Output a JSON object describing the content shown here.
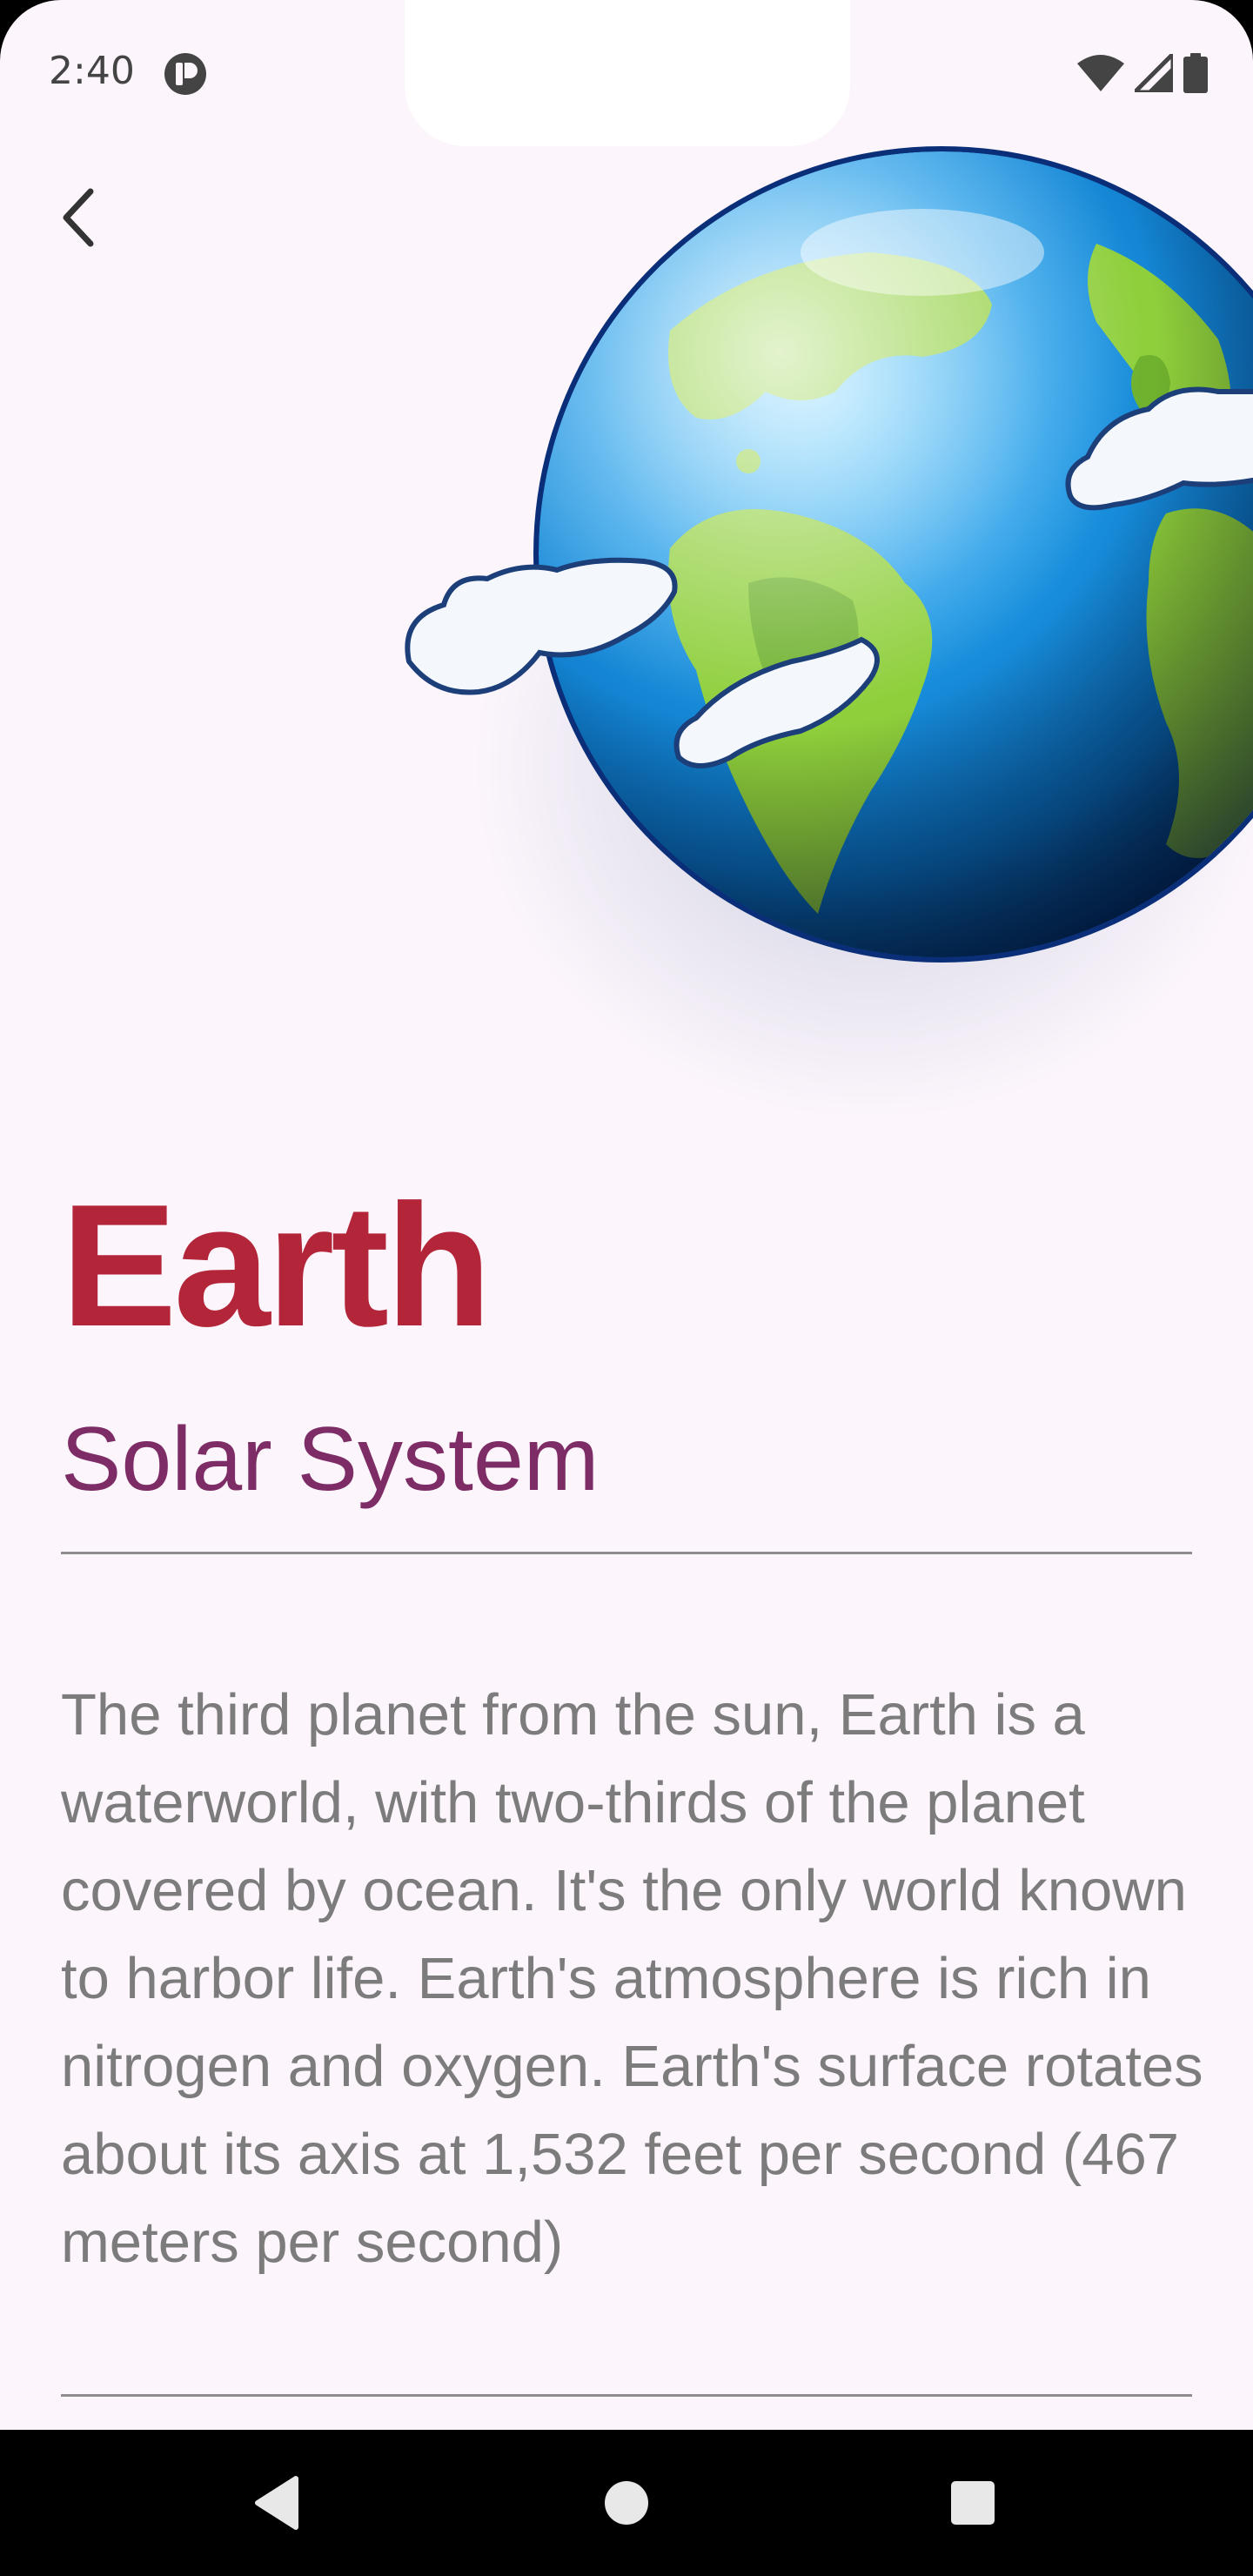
{
  "status_bar": {
    "time": "2:40",
    "icons": [
      "notification-icon",
      "wifi-icon",
      "signal-icon",
      "battery-icon"
    ]
  },
  "navigation": {
    "back_icon": "chevron-left-icon"
  },
  "planet": {
    "image": "earth-illustration",
    "name": "Earth",
    "category": "Solar System",
    "description": "The third planet from the sun, Earth is a waterworld, with two-thirds of the planet covered by ocean. It's the only world known to harbor life. Earth's atmosphere is rich in nitrogen and oxygen. Earth's surface rotates about its axis at 1,532 feet per second (467 meters per second)"
  },
  "system_nav": {
    "back": "triangle-back-icon",
    "home": "circle-home-icon",
    "recents": "square-recents-icon"
  },
  "colors": {
    "background": "#fcf5fc",
    "title": "#b3263a",
    "subtitle": "#7d2c66",
    "body_text": "#7c7c7c",
    "divider": "#8e8e8e"
  }
}
